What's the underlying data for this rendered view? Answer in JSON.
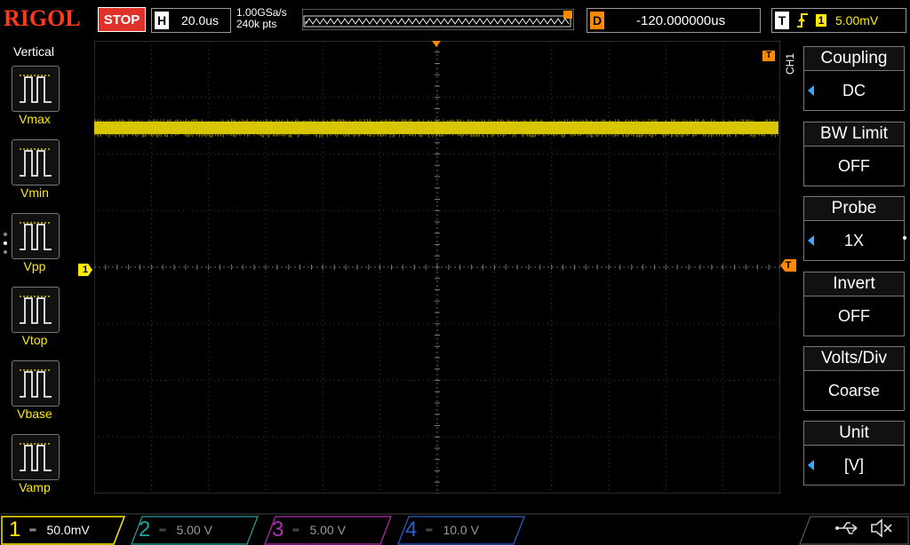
{
  "header": {
    "brand": "RIGOL",
    "run_status": "STOP",
    "horizontal": {
      "letter": "H",
      "value": "20.0us"
    },
    "sample_rate": "1.00GSa/s",
    "memory_depth": "240k pts",
    "delay": {
      "letter": "D",
      "value": "-120.000000us"
    },
    "trigger": {
      "letter": "T",
      "source": "1",
      "level": "5.00mV"
    }
  },
  "left_menu": {
    "title": "Vertical",
    "items": [
      {
        "label": "Vmax"
      },
      {
        "label": "Vmin"
      },
      {
        "label": "Vpp"
      },
      {
        "label": "Vtop"
      },
      {
        "label": "Vbase"
      },
      {
        "label": "Vamp"
      }
    ]
  },
  "right_menu": {
    "channel_tag": "CH1",
    "items": [
      {
        "title": "Coupling",
        "value": "DC",
        "has_arrow": true
      },
      {
        "title": "BW Limit",
        "value": "OFF",
        "has_arrow": false
      },
      {
        "title": "Probe",
        "value": "1X",
        "has_arrow": true
      },
      {
        "title": "Invert",
        "value": "OFF",
        "has_arrow": false
      },
      {
        "title": "Volts/Div",
        "value": "Coarse",
        "has_arrow": false
      },
      {
        "title": "Unit",
        "value": "[V]",
        "has_arrow": true
      }
    ]
  },
  "markers": {
    "channel1_ground": "1",
    "trigger_level": "T",
    "trigger_pos": "T"
  },
  "channels": [
    {
      "num": "1",
      "scale": "50.0mV",
      "color": "#ffea00",
      "active": true
    },
    {
      "num": "2",
      "scale": "5.00 V",
      "color": "#1fa3a0",
      "active": false
    },
    {
      "num": "3",
      "scale": "5.00 V",
      "color": "#b02fb0",
      "active": false
    },
    {
      "num": "4",
      "scale": "10.0 V",
      "color": "#2a5fd0",
      "active": false
    }
  ],
  "colors": {
    "ch1": "#ffea00",
    "accent_orange": "#ff8a00",
    "stop_red": "#e0302a",
    "menu_arrow": "#33aaff"
  },
  "icons": [
    "usb-icon",
    "speaker-muted-icon"
  ]
}
